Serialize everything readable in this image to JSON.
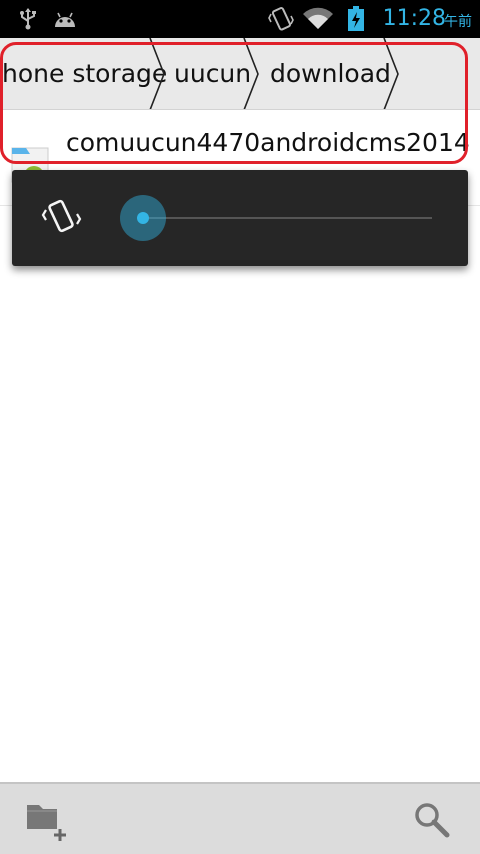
{
  "status_bar": {
    "time": "11:28",
    "time_suffix": "午前",
    "icons": [
      "usb-icon",
      "android-icon",
      "vibrate-icon",
      "wifi-icon",
      "battery-charging-icon"
    ],
    "accent": "#33b5e5"
  },
  "breadcrumb": {
    "items": [
      "hone storage",
      "uucun",
      "download"
    ]
  },
  "file_list": {
    "items": [
      {
        "name": "comuucun4470androidcms2014",
        "icon": "apk-file-icon"
      }
    ]
  },
  "volume_panel": {
    "icon": "vibrate-icon",
    "level": 0
  },
  "bottom_bar": {
    "buttons": [
      "new-folder-icon",
      "search-icon"
    ]
  },
  "colors": {
    "highlight": "#e0202a",
    "status_bar_bg": "#000000",
    "panel_bg": "#262626"
  }
}
